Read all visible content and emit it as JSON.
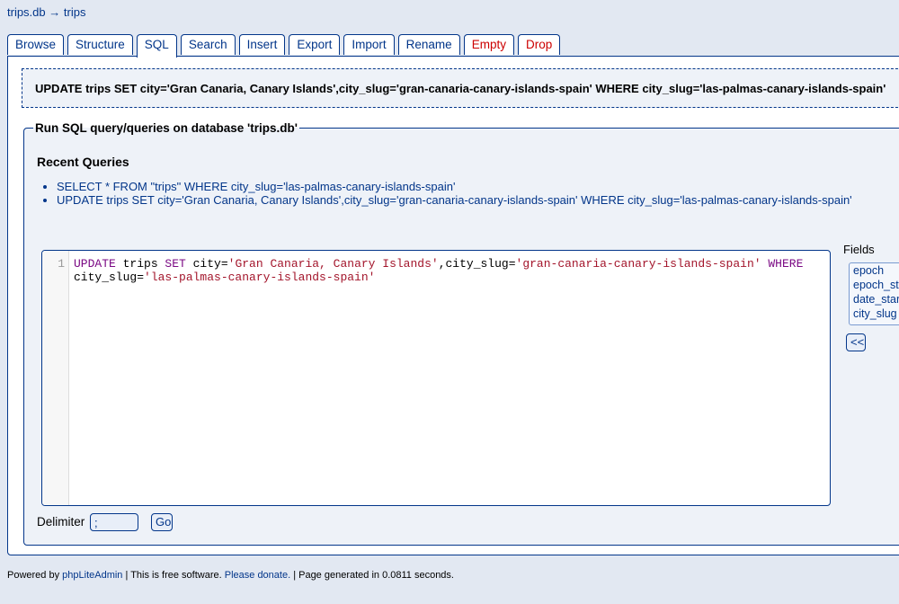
{
  "breadcrumb": {
    "database": "trips.db",
    "arrow": "→",
    "table": "trips"
  },
  "tabs": [
    {
      "label": "Browse"
    },
    {
      "label": "Structure"
    },
    {
      "label": "SQL"
    },
    {
      "label": "Search"
    },
    {
      "label": "Insert"
    },
    {
      "label": "Export"
    },
    {
      "label": "Import"
    },
    {
      "label": "Rename"
    },
    {
      "label": "Empty"
    },
    {
      "label": "Drop"
    }
  ],
  "active_tab": "SQL",
  "executed_query": "UPDATE trips SET city='Gran Canaria, Canary Islands',city_slug='gran-canaria-canary-islands-spain' WHERE city_slug='las-palmas-canary-islands-spain'",
  "run_panel": {
    "legend": "Run SQL query/queries on database 'trips.db'",
    "recent_title": "Recent Queries",
    "recent": [
      "SELECT * FROM \"trips\" WHERE city_slug='las-palmas-canary-islands-spain'",
      "UPDATE trips SET city='Gran Canaria, Canary Islands',city_slug='gran-canaria-canary-islands-spain' WHERE city_slug='las-palmas-canary-islands-spain'"
    ]
  },
  "editor": {
    "line_number": "1",
    "tokens": {
      "kw_update": "UPDATE",
      "t_table": " trips ",
      "kw_set": "SET",
      "t_city": " city=",
      "s_city": "'Gran Canaria, Canary Islands'",
      "t_slug": ",city_slug=",
      "s_slug": "'gran-canaria-canary-islands-spain'",
      "kw_where": " WHERE",
      "t_where_slug": " city_slug=",
      "s_where": "'las-palmas-canary-islands-spain'"
    }
  },
  "fields": {
    "label": "Fields",
    "items": [
      "epoch",
      "epoch_start",
      "date_start",
      "city_slug"
    ],
    "insert_button": "<<"
  },
  "delimiter": {
    "label": "Delimiter",
    "value": ";",
    "go_button": "Go"
  },
  "footer": {
    "prefix": "Powered by ",
    "app_link": "phpLiteAdmin",
    "middle": " | This is free software. ",
    "donate_link": "Please donate.",
    "suffix": " | Page generated in 0.0811 seconds."
  }
}
